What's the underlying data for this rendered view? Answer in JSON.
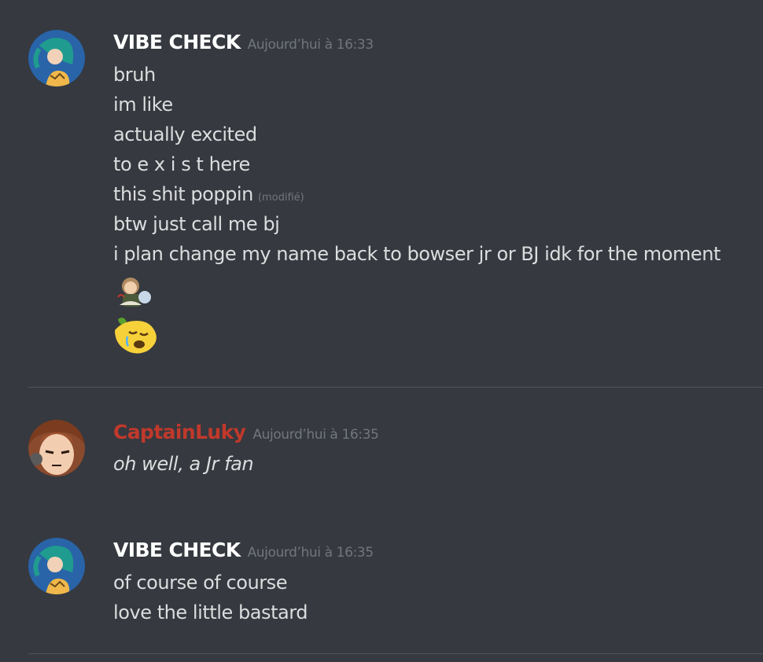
{
  "messages": [
    {
      "author": "VIBE CHECK",
      "author_color": "#ffffff",
      "timestamp": "Aujourd’hui à 16:33",
      "lines": [
        "bruh",
        "im like",
        "actually excited",
        "to e x i s t here",
        "this shit poppin",
        "btw just call me bj",
        "i plan change my name back to bowser jr or BJ idk for the moment"
      ],
      "edited_label": "(modifié)",
      "emojis": [
        "custom-character-emoji",
        "sad-lemon-emoji"
      ]
    },
    {
      "author": "CaptainLuky",
      "author_color": "#c0392b",
      "timestamp": "Aujourd’hui à 16:35",
      "lines": [
        "oh well, a Jr fan"
      ]
    },
    {
      "author": "VIBE CHECK",
      "author_color": "#ffffff",
      "timestamp": "Aujourd’hui à 16:35",
      "lines": [
        "of course of course",
        "love the little bastard"
      ]
    }
  ],
  "colors": {
    "background": "#36393f",
    "text": "#dcddde",
    "muted": "#72767d",
    "divider": "#4f545c"
  }
}
